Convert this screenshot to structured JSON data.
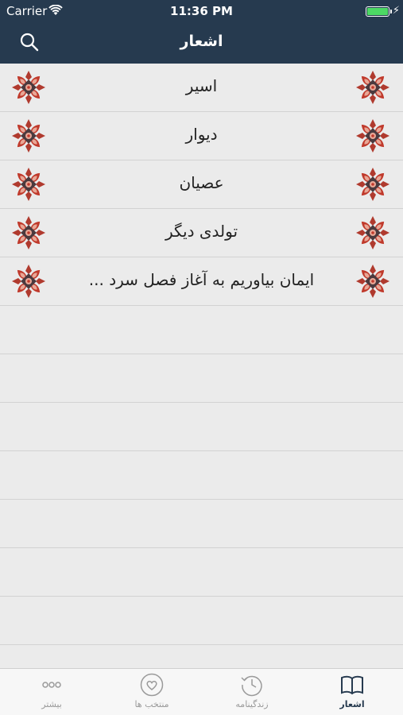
{
  "status_bar": {
    "carrier": "Carrier",
    "time": "11:36 PM",
    "battery_percent": 100,
    "icons": [
      "wifi-icon",
      "battery-icon",
      "charging-bolt-icon"
    ]
  },
  "nav_bar": {
    "title": "اشعار",
    "search_icon": "search-icon"
  },
  "poems": [
    {
      "title": "اسیر"
    },
    {
      "title": "دیوار"
    },
    {
      "title": "عصیان"
    },
    {
      "title": "تولدی دیگر"
    },
    {
      "title": "ایمان بیاوریم به آغاز فصل سرد ..."
    }
  ],
  "tab_bar": {
    "active": "poems",
    "tabs": [
      {
        "id": "more",
        "label": "بیشتر",
        "icon": "more-dots-icon"
      },
      {
        "id": "favorites",
        "label": "منتخب ها",
        "icon": "heart-icon"
      },
      {
        "id": "biography",
        "label": "زندگینامه",
        "icon": "history-clock-icon"
      },
      {
        "id": "poems",
        "label": "اشعار",
        "icon": "open-book-icon"
      }
    ]
  },
  "colors": {
    "header": "#263a4f",
    "list_background": "#ebebeb",
    "divider": "#d2d2d2",
    "active_tab": "#263a4f",
    "inactive_tab": "#9a9a9a",
    "ornament_red": "#c0392b",
    "ornament_pink": "#e8a796",
    "ornament_dark": "#4b3a3e"
  }
}
